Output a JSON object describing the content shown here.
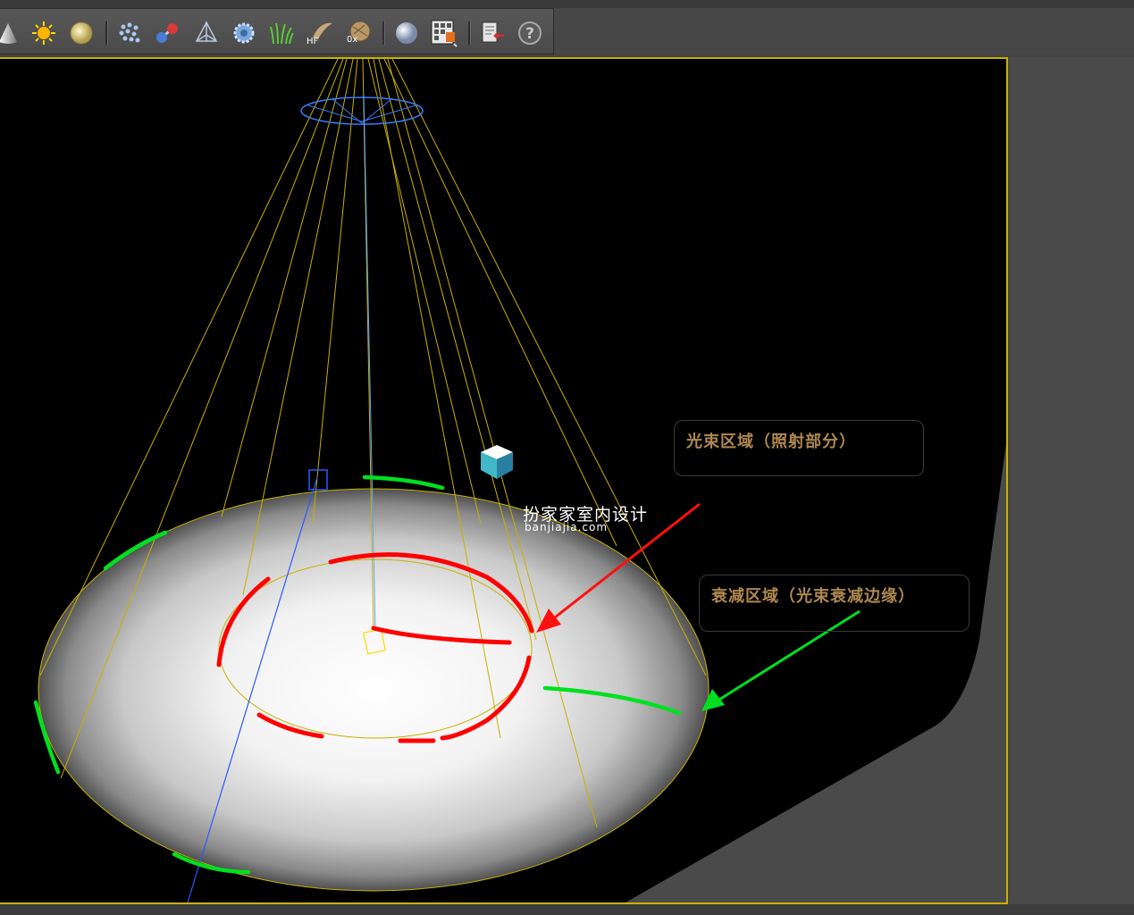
{
  "toolbar": {
    "buttons": [
      {
        "icon": "cone-icon"
      },
      {
        "icon": "sun-light-icon"
      },
      {
        "icon": "sky-light-icon"
      },
      {
        "icon": "particles-icon"
      },
      {
        "icon": "molecule-icon"
      },
      {
        "icon": "pyramid-mesh-icon"
      },
      {
        "icon": "gear-mesh-icon"
      },
      {
        "icon": "grass-icon"
      },
      {
        "icon": "hair-fur-icon",
        "label": "HF"
      },
      {
        "icon": "proxy-icon",
        "label": "0x"
      },
      {
        "icon": "sphere-material-icon"
      },
      {
        "icon": "material-grid-icon"
      },
      {
        "icon": "import-icon"
      },
      {
        "icon": "help-icon",
        "label": "?"
      }
    ]
  },
  "annotations": {
    "beam": "光束区域（照射部分）",
    "falloff": "衰减区域（光束衰减边缘）"
  },
  "watermark": {
    "title": "扮家家室内设计",
    "subtitle": "banjiajia.com"
  },
  "colors": {
    "viewport_border": "#c8b200",
    "beam_marker": "#ff0000",
    "falloff_marker": "#00e020",
    "light_cone": "#c8b000",
    "target_line": "#3a8aff",
    "annotation_text": "#b08850"
  }
}
